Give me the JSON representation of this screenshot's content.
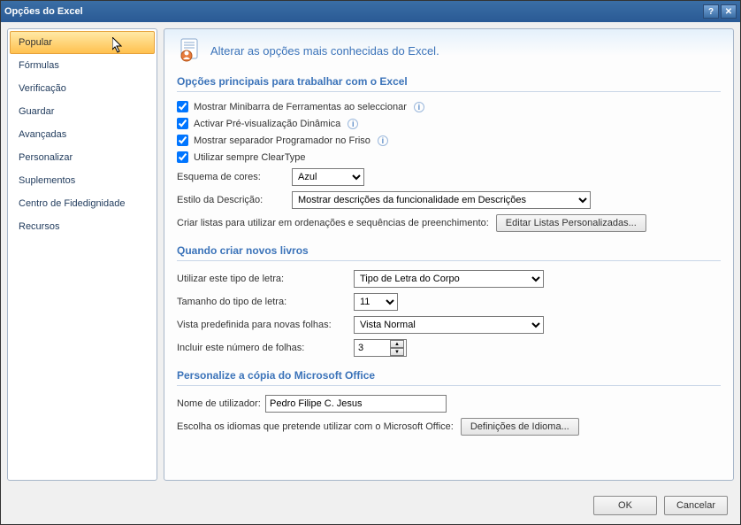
{
  "window": {
    "title": "Opções do Excel"
  },
  "sidebar": {
    "items": [
      {
        "label": "Popular",
        "active": true
      },
      {
        "label": "Fórmulas"
      },
      {
        "label": "Verificação"
      },
      {
        "label": "Guardar"
      },
      {
        "label": "Avançadas"
      },
      {
        "label": "Personalizar"
      },
      {
        "label": "Suplementos"
      },
      {
        "label": "Centro de Fidedignidade"
      },
      {
        "label": "Recursos"
      }
    ]
  },
  "heading": "Alterar as opções mais conhecidas do Excel.",
  "section1": {
    "title": "Opções principais para trabalhar com o Excel",
    "opt1": "Mostrar Minibarra de Ferramentas ao seleccionar",
    "opt2": "Activar Pré-visualização Dinâmica",
    "opt3": "Mostrar separador Programador no Friso",
    "opt4": "Utilizar sempre ClearType",
    "color_label": "Esquema de cores:",
    "color_value": "Azul",
    "tooltip_label": "Estilo da Descrição:",
    "tooltip_value": "Mostrar descrições da funcionalidade em Descrições",
    "lists_label": "Criar listas para utilizar em ordenações e sequências de preenchimento:",
    "lists_btn": "Editar Listas Personalizadas..."
  },
  "section2": {
    "title": "Quando criar novos livros",
    "font_label": "Utilizar este tipo de letra:",
    "font_value": "Tipo de Letra do Corpo",
    "size_label": "Tamanho do tipo de letra:",
    "size_value": "11",
    "view_label": "Vista predefinida para novas folhas:",
    "view_value": "Vista Normal",
    "sheets_label": "Incluir este número de folhas:",
    "sheets_value": "3"
  },
  "section3": {
    "title": "Personalize a cópia do Microsoft Office",
    "user_label": "Nome de utilizador:",
    "user_value": "Pedro Filipe C. Jesus",
    "lang_label": "Escolha os idiomas que pretende utilizar com o Microsoft Office:",
    "lang_btn": "Definições de Idioma..."
  },
  "footer": {
    "ok": "OK",
    "cancel": "Cancelar"
  }
}
